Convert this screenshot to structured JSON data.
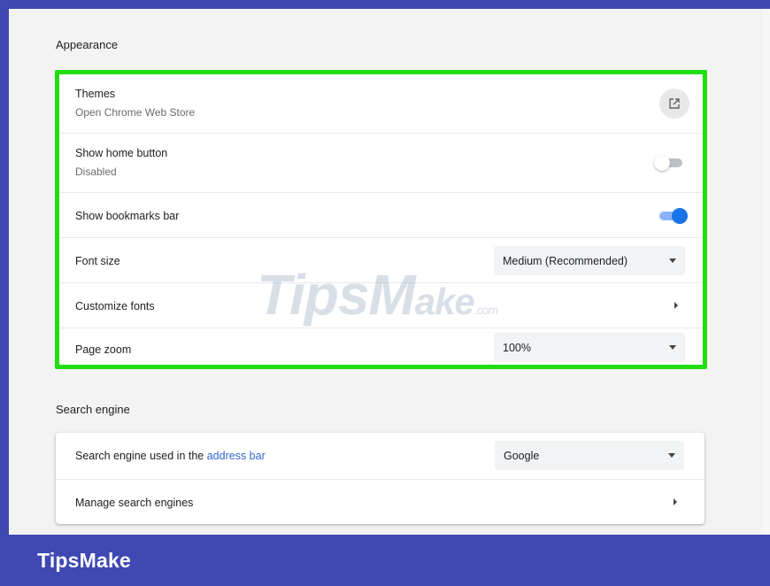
{
  "appearance": {
    "title": "Appearance",
    "themes": {
      "label": "Themes",
      "sublabel": "Open Chrome Web Store",
      "icon": "open-in-new-icon"
    },
    "home_button": {
      "label": "Show home button",
      "sublabel": "Disabled",
      "enabled": false
    },
    "bookmarks_bar": {
      "label": "Show bookmarks bar",
      "enabled": true
    },
    "font_size": {
      "label": "Font size",
      "value": "Medium (Recommended)"
    },
    "customize_fonts": {
      "label": "Customize fonts"
    },
    "page_zoom": {
      "label": "Page zoom",
      "value": "100%"
    }
  },
  "search_engine": {
    "title": "Search engine",
    "used_in": {
      "label_prefix": "Search engine used in the",
      "label_link": "address bar",
      "value": "Google"
    },
    "manage": {
      "label": "Manage search engines"
    }
  },
  "watermark": {
    "part1": "Tips",
    "part2": "M",
    "part3": "ake",
    "suffix": ".com"
  },
  "footer": {
    "brand": "TipsMake"
  },
  "colors": {
    "highlight_border": "#22dd11",
    "frame": "#3f48b3",
    "toggle_on": "#1a73e8",
    "link": "#3367d6"
  }
}
